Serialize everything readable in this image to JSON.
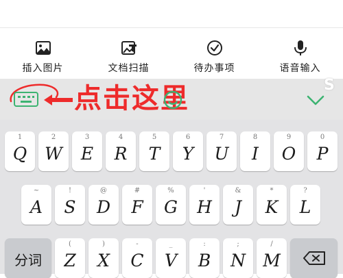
{
  "toolbar": {
    "items": [
      {
        "label": "插入图片",
        "icon": "image-icon"
      },
      {
        "label": "文档扫描",
        "icon": "document-scan-icon"
      },
      {
        "label": "待办事项",
        "icon": "check-circle-icon"
      },
      {
        "label": "语音输入",
        "icon": "microphone-icon"
      }
    ]
  },
  "ime_bar": {
    "annotation_text": "点击这里",
    "watermark": "S"
  },
  "keyboard": {
    "row1": [
      {
        "hint": "1",
        "key": "Q"
      },
      {
        "hint": "2",
        "key": "W"
      },
      {
        "hint": "3",
        "key": "E"
      },
      {
        "hint": "4",
        "key": "R"
      },
      {
        "hint": "5",
        "key": "T"
      },
      {
        "hint": "6",
        "key": "Y"
      },
      {
        "hint": "7",
        "key": "U"
      },
      {
        "hint": "8",
        "key": "I"
      },
      {
        "hint": "9",
        "key": "O"
      },
      {
        "hint": "0",
        "key": "P"
      }
    ],
    "row2": [
      {
        "hint": "~",
        "key": "A"
      },
      {
        "hint": "!",
        "key": "S"
      },
      {
        "hint": "@",
        "key": "D"
      },
      {
        "hint": "#",
        "key": "F"
      },
      {
        "hint": "%",
        "key": "G"
      },
      {
        "hint": "'",
        "key": "H"
      },
      {
        "hint": "&",
        "key": "J"
      },
      {
        "hint": "*",
        "key": "K"
      },
      {
        "hint": "?",
        "key": "L"
      }
    ],
    "row3": [
      {
        "hint": "(",
        "key": "Z"
      },
      {
        "hint": ")",
        "key": "X"
      },
      {
        "hint": "-",
        "key": "C"
      },
      {
        "hint": "_",
        "key": "V"
      },
      {
        "hint": ":",
        "key": "B"
      },
      {
        "hint": ";",
        "key": "N"
      },
      {
        "hint": "/",
        "key": "M"
      }
    ],
    "segment_label": "分词"
  },
  "colors": {
    "accent_green": "#3cb371",
    "annotation_red": "#ee2b2b",
    "keyboard_bg": "#e3e3e5"
  }
}
